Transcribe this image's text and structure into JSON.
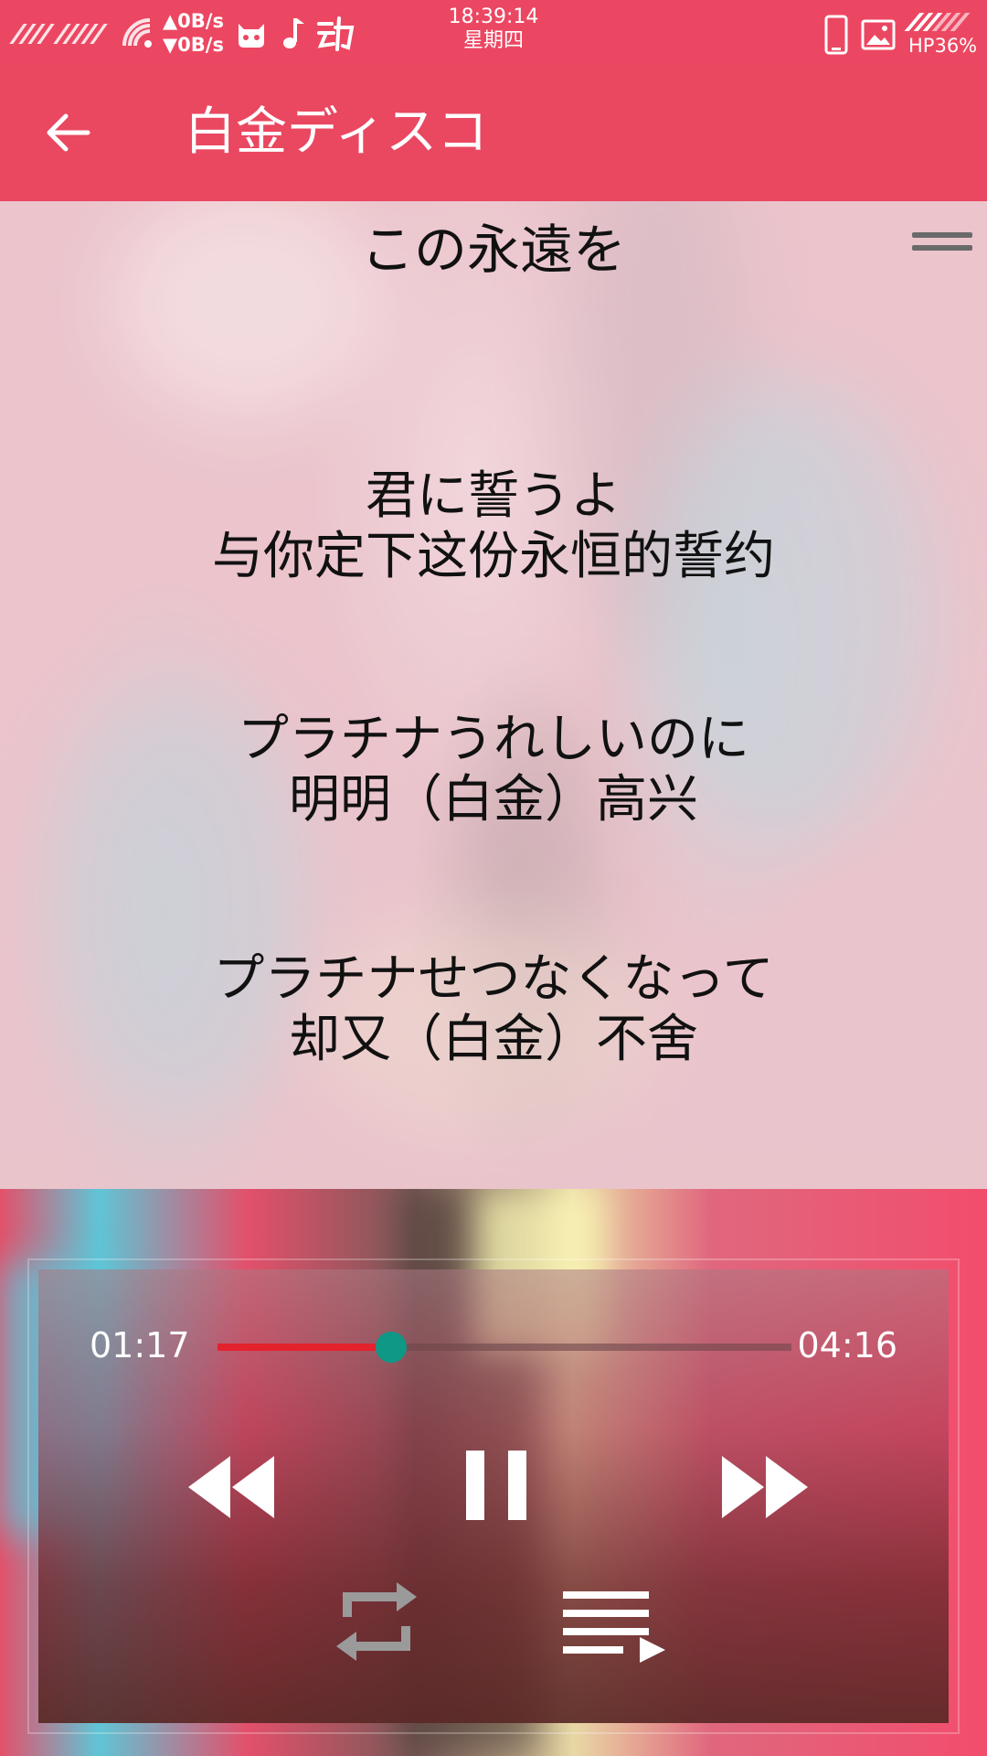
{
  "status_bar": {
    "upload_speed": "▲0B/s",
    "download_speed": "▼0B/s",
    "time": "18:39:14",
    "weekday": "星期四",
    "battery": "HP36%",
    "icons": [
      "signal-icon",
      "wifi-icon",
      "cat-app-icon",
      "music-note-icon",
      "dong-app-icon",
      "phone-icon",
      "image-icon",
      "signal-icon"
    ]
  },
  "toolbar": {
    "title": "白金ディスコ"
  },
  "lyrics": {
    "current_line": "この永遠を",
    "blocks": [
      {
        "original": "君に誓うよ",
        "translation": "与你定下这份永恒的誓约"
      },
      {
        "original": "プラチナうれしいのに",
        "translation": "明明（白金）高兴"
      },
      {
        "original": "プラチナせつなくなって",
        "translation": "却又（白金）不舍"
      }
    ]
  },
  "player": {
    "current_time": "01:17",
    "total_time": "04:16",
    "progress": 0.302,
    "colors": {
      "progress_fill": "#e3222d",
      "thumb": "#0f9886",
      "toolbar": "#ea4761"
    }
  }
}
